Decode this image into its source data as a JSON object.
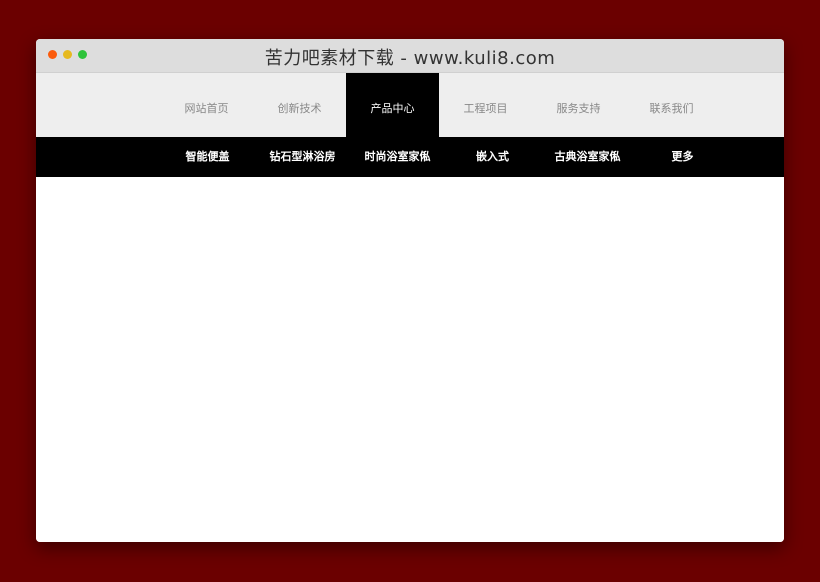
{
  "window": {
    "title": "苦力吧素材下载 - www.kuli8.com"
  },
  "main_nav": {
    "items": [
      {
        "label": "网站首页"
      },
      {
        "label": "创新技术"
      },
      {
        "label": "产品中心",
        "active": true
      },
      {
        "label": "工程项目"
      },
      {
        "label": "服务支持"
      },
      {
        "label": "联系我们"
      }
    ]
  },
  "sub_nav": {
    "items": [
      {
        "label": "智能便盖"
      },
      {
        "label": "钻石型淋浴房"
      },
      {
        "label": "时尚浴室家俬"
      },
      {
        "label": "嵌入式"
      },
      {
        "label": "古典浴室家俬"
      },
      {
        "label": "更多"
      }
    ]
  },
  "colors": {
    "page_background": "#6b0000",
    "titlebar": "#dddddd",
    "main_nav_background": "#eeeeee",
    "main_nav_text": "#888888",
    "active_background": "#000000",
    "sub_nav_background": "#000000",
    "sub_nav_text": "#ffffff",
    "dot_close": "#fb5b0c",
    "dot_minimize": "#e6b91f",
    "dot_maximize": "#2ec33b"
  }
}
